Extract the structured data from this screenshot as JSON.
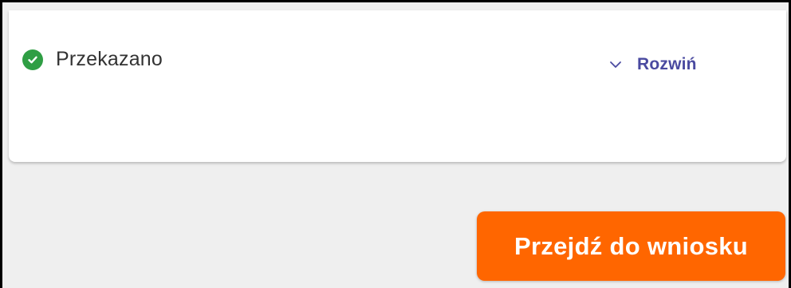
{
  "status": {
    "icon": "check-circle-icon",
    "label": "Przekazano",
    "color": "#2f9e44"
  },
  "expand_toggle": {
    "icon": "chevron-down-icon",
    "label": "Rozwiń",
    "color": "#4a4aa0"
  },
  "primary_action": {
    "label": "Przejdź do wniosku",
    "background": "#ff6600"
  },
  "colors": {
    "page_background": "#efefef",
    "card_background": "#ffffff"
  }
}
